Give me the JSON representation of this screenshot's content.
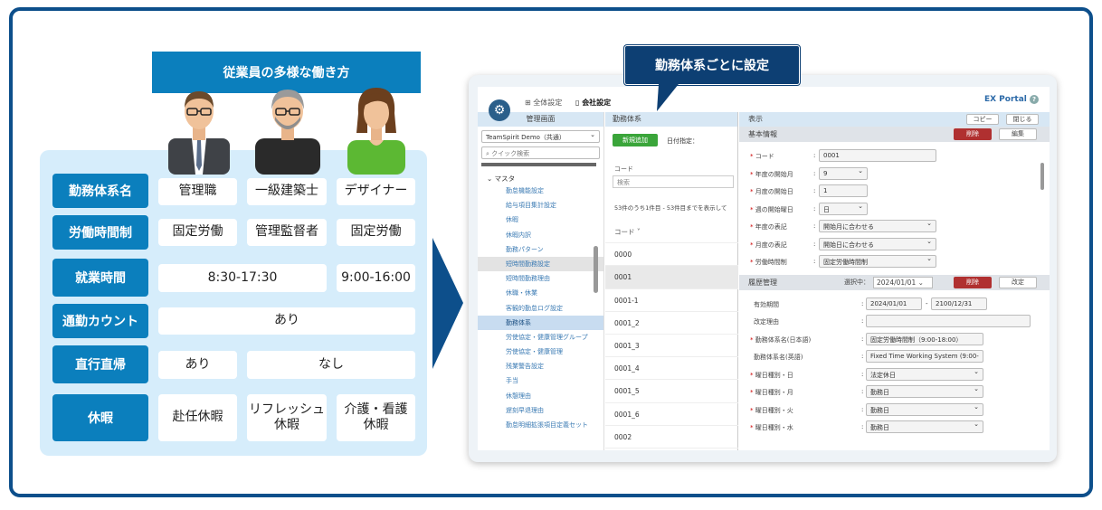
{
  "left": {
    "banner": "従業員の多様な働き方",
    "rows": [
      {
        "header": "勤務体系名",
        "cells": [
          "管理職",
          "一級建築士",
          "デザイナー"
        ]
      },
      {
        "header": "労働時間制",
        "cells": [
          "固定労働",
          "管理監督者",
          "固定労働"
        ]
      },
      {
        "header": "就業時間",
        "cells": [
          "8:30-17:30",
          "9:00-16:00"
        ]
      },
      {
        "header": "通勤カウント",
        "cells": [
          "あり"
        ]
      },
      {
        "header": "直行直帰",
        "cells": [
          "あり",
          "なし"
        ]
      },
      {
        "header": "休暇",
        "cells": [
          "赴任休暇",
          "リフレッシュ\n休暇",
          "介護・看護\n休暇"
        ]
      }
    ]
  },
  "callout": "勤務体系ごとに設定",
  "app": {
    "nav": {
      "all_settings": "全体設定",
      "company_settings": "会社設定",
      "portal": "EX Portal"
    },
    "icons": {
      "gear": "gear-icon",
      "help": "help-icon"
    },
    "left_col": {
      "title": "管理画面",
      "org_select": "TeamSpirit Demo（共通）",
      "search_placeholder": "クイック検索",
      "tree_head": "マスタ",
      "items": [
        "勤怠機能設定",
        "給与項目集計設定",
        "休暇",
        "休暇内訳",
        "勤務パターン",
        "短時間勤務設定",
        "短時間勤務理由",
        "休職・休業",
        "客観的勤怠ログ設定",
        "勤務体系",
        "労使協定・健康管理グループ",
        "労使協定・健康管理",
        "残業警告設定",
        "手当",
        "休憩理由",
        "遅刻早退理由",
        "勤怠明細拡張項目定義セット"
      ]
    },
    "mid_col": {
      "title": "勤務体系",
      "new_button": "新規追加",
      "date_label": "日付指定：",
      "code_label": "コード",
      "search_placeholder": "検索",
      "count_text": "53件のうち1件目 - 53件目までを表示して",
      "column_header": "コード ˅",
      "codes": [
        "0000",
        "0001",
        "0001-1",
        "0001_2",
        "0001_3",
        "0001_4",
        "0001_5",
        "0001_6",
        "0002"
      ]
    },
    "right_col": {
      "title": "表示",
      "copy_button": "コピー",
      "close_button": "閉じる",
      "basic_section": "基本情報",
      "delete_button": "削除",
      "edit_button": "編集",
      "basic_fields": [
        {
          "label": "コード",
          "value": "0001",
          "dropdown": false
        },
        {
          "label": "年度の開始月",
          "value": "9",
          "dropdown": true
        },
        {
          "label": "月度の開始日",
          "value": "1",
          "dropdown": false
        },
        {
          "label": "週の開始曜日",
          "value": "日",
          "dropdown": true
        },
        {
          "label": "年度の表記",
          "value": "開始月に合わせる",
          "dropdown": true
        },
        {
          "label": "月度の表記",
          "value": "開始日に合わせる",
          "dropdown": true
        },
        {
          "label": "労働時間制",
          "value": "固定労働時間制",
          "dropdown": true
        }
      ],
      "history_section": "履歴管理",
      "selected_label": "選択中：",
      "selected_date": "2024/01/01",
      "history_delete": "削除",
      "revise_button": "改定",
      "period_label": "有効期間",
      "period_from": "2024/01/01",
      "period_sep": "-",
      "period_to": "2100/12/31",
      "reason_label": "改定理由",
      "history_fields": [
        {
          "label": "勤務体系名(日本語)",
          "value": "固定労働時間制（9:00-18:00）",
          "required": true,
          "dropdown": false
        },
        {
          "label": "勤務体系名(英語)",
          "value": "Fixed Time Working System (9:00-",
          "required": false,
          "dropdown": false
        },
        {
          "label": "曜日種別・日",
          "value": "法定休日",
          "required": true,
          "dropdown": true
        },
        {
          "label": "曜日種別・月",
          "value": "勤務日",
          "required": true,
          "dropdown": true
        },
        {
          "label": "曜日種別・火",
          "value": "勤務日",
          "required": true,
          "dropdown": true
        },
        {
          "label": "曜日種別・水",
          "value": "勤務日",
          "required": true,
          "dropdown": true
        }
      ]
    }
  }
}
